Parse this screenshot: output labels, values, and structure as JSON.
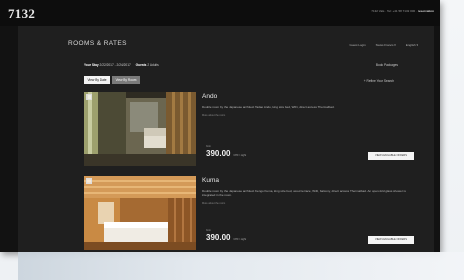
{
  "brand": {
    "logo": "7132"
  },
  "topbar": {
    "contact_prefix": "7132 Vals · Tel: +41 58 7132 000 ·",
    "contact_link": "reservation"
  },
  "page": {
    "title": "ROOMS & RATES",
    "login": "Guest Login",
    "currency": "Swiss Francs ▾",
    "language": "English ▾"
  },
  "stay": {
    "label": "Your Stay",
    "dates": "2/22/2017 - 2/24/2017",
    "guests_label": "Guests",
    "guests": "2 Adults"
  },
  "actions": {
    "book_link": "Book Packages",
    "sort_by_date": "View By Date",
    "sort_by_room": "View By Room",
    "refine": "+ Refine Your Search"
  },
  "rooms": [
    {
      "name": "Ando",
      "description": "Double room by the Japanese architect Tadao Ando, king size bed, WiFi, direct access Thermalbad.",
      "more": "More about the room",
      "price_from": "from",
      "price": "390.00",
      "price_unit": "CHF / night",
      "cta": "VIEW AVAILABLE OFFERS"
    },
    {
      "name": "Kuma",
      "description": "Double room by the Japanese architect Kengo Kuma, king size bed, wood terrace, WiFi, balcony, direct access Thermalbad. An open-fold glass shower is integrated in the room.",
      "more": "More about the room",
      "price_from": "from",
      "price": "390.00",
      "price_unit": "CHF / night",
      "cta": "VIEW AVAILABLE OFFERS"
    }
  ]
}
